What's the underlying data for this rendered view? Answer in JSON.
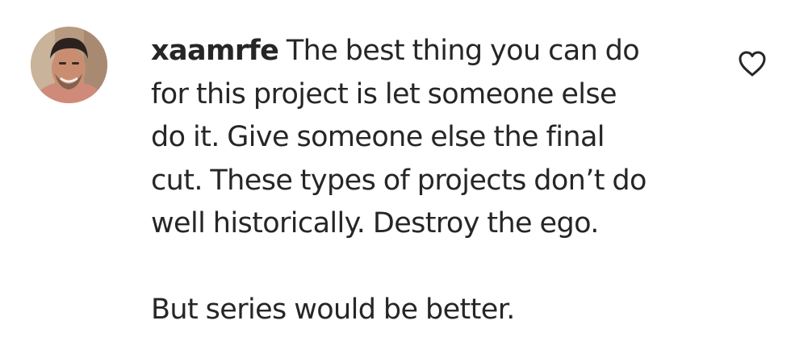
{
  "comment": {
    "username": "xaamrfe",
    "lines": [
      "The best thing you can do",
      "for this project is let someone else",
      "do it. Give someone else the final",
      "cut. These types of projects don’t do",
      "well historically. Destroy the ego."
    ],
    "second_paragraph": "But series would be better.",
    "avatar_icon": "user-avatar-photo",
    "like_icon": "heart-outline-icon"
  }
}
